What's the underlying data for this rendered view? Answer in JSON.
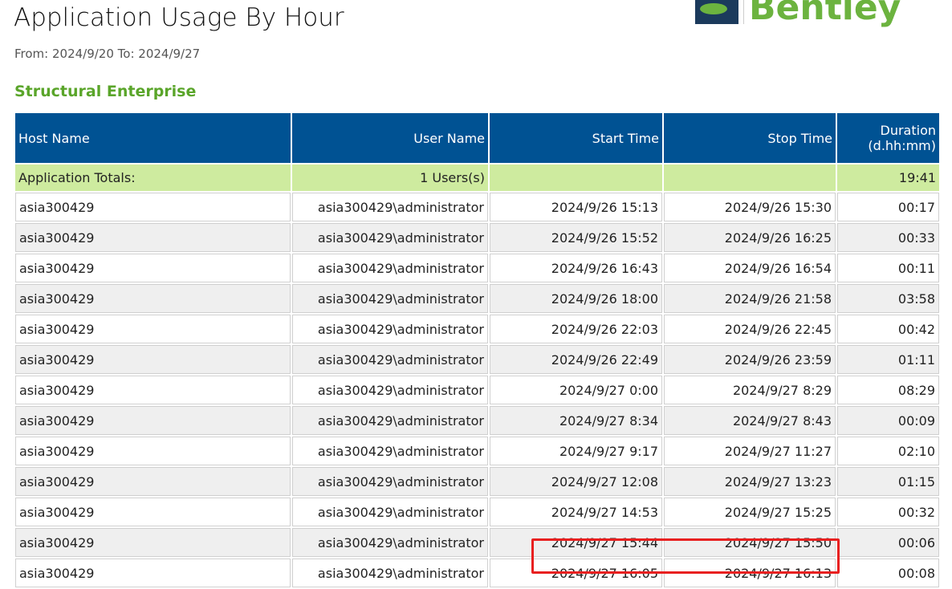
{
  "report": {
    "title": "Application Usage By Hour",
    "range": "From: 2024/9/20 To: 2024/9/27",
    "section": "Structural Enterprise",
    "logo_text": "Bentley"
  },
  "columns": [
    "Host Name",
    "User Name",
    "Start Time",
    "Stop Time",
    "Duration (d.hh:mm)"
  ],
  "totals": {
    "label": "Application Totals:",
    "users": "1 Users(s)",
    "duration": "19:41"
  },
  "rows": [
    [
      "asia300429",
      "asia300429\\administrator",
      "2024/9/26 15:13",
      "2024/9/26 15:30",
      "00:17"
    ],
    [
      "asia300429",
      "asia300429\\administrator",
      "2024/9/26 15:52",
      "2024/9/26 16:25",
      "00:33"
    ],
    [
      "asia300429",
      "asia300429\\administrator",
      "2024/9/26 16:43",
      "2024/9/26 16:54",
      "00:11"
    ],
    [
      "asia300429",
      "asia300429\\administrator",
      "2024/9/26 18:00",
      "2024/9/26 21:58",
      "03:58"
    ],
    [
      "asia300429",
      "asia300429\\administrator",
      "2024/9/26 22:03",
      "2024/9/26 22:45",
      "00:42"
    ],
    [
      "asia300429",
      "asia300429\\administrator",
      "2024/9/26 22:49",
      "2024/9/26 23:59",
      "01:11"
    ],
    [
      "asia300429",
      "asia300429\\administrator",
      "2024/9/27 0:00",
      "2024/9/27 8:29",
      "08:29"
    ],
    [
      "asia300429",
      "asia300429\\administrator",
      "2024/9/27 8:34",
      "2024/9/27 8:43",
      "00:09"
    ],
    [
      "asia300429",
      "asia300429\\administrator",
      "2024/9/27 9:17",
      "2024/9/27 11:27",
      "02:10"
    ],
    [
      "asia300429",
      "asia300429\\administrator",
      "2024/9/27 12:08",
      "2024/9/27 13:23",
      "01:15"
    ],
    [
      "asia300429",
      "asia300429\\administrator",
      "2024/9/27 14:53",
      "2024/9/27 15:25",
      "00:32"
    ],
    [
      "asia300429",
      "asia300429\\administrator",
      "2024/9/27 15:44",
      "2024/9/27 15:50",
      "00:06"
    ],
    [
      "asia300429",
      "asia300429\\administrator",
      "2024/9/27 16:05",
      "2024/9/27 16:13",
      "00:08"
    ]
  ]
}
